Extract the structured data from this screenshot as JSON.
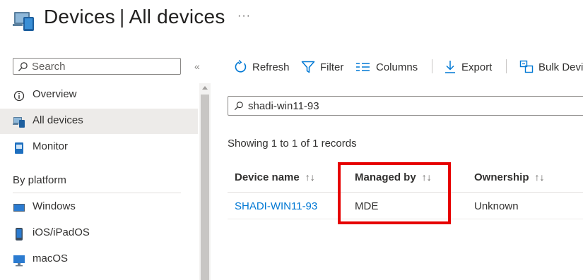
{
  "header": {
    "title_main": "Devices",
    "title_separator": "|",
    "title_sub": "All devices",
    "more_label": "···"
  },
  "sidebar": {
    "search_placeholder": "Search",
    "collapse_label": "«",
    "items": [
      {
        "label": "Overview",
        "icon": "info-icon"
      },
      {
        "label": "All devices",
        "icon": "devices-icon",
        "active": true
      },
      {
        "label": "Monitor",
        "icon": "monitor-icon"
      }
    ],
    "section_title": "By platform",
    "platforms": [
      {
        "label": "Windows",
        "icon": "windows-icon"
      },
      {
        "label": "iOS/iPadOS",
        "icon": "phone-icon"
      },
      {
        "label": "macOS",
        "icon": "mac-icon"
      }
    ]
  },
  "toolbar": {
    "refresh": "Refresh",
    "filter": "Filter",
    "columns": "Columns",
    "export": "Export",
    "bulk": "Bulk Devi"
  },
  "search": {
    "value": "shadi-win11-93"
  },
  "records_text": "Showing 1 to 1 of 1 records",
  "table": {
    "columns": [
      "Device name",
      "Managed by",
      "Ownership"
    ],
    "sort_glyph": "↑↓",
    "rows": [
      {
        "device_name": "SHADI-WIN11-93",
        "managed_by": "MDE",
        "ownership": "Unknown"
      }
    ]
  },
  "colors": {
    "accent": "#0078d4",
    "highlight": "#e60000",
    "active_item_bg": "#edebe9"
  }
}
